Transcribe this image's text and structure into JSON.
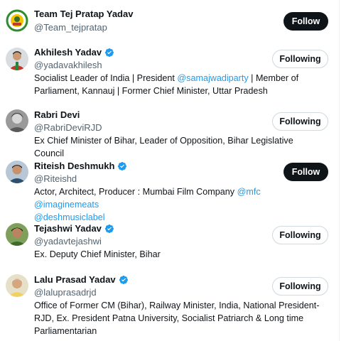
{
  "accounts": [
    {
      "name": "Team Tej Pratap Yadav",
      "handle": "@Team_tejpratap",
      "verified": false,
      "button": "Follow",
      "bio": []
    },
    {
      "name": "Akhilesh Yadav",
      "handle": "@yadavakhilesh",
      "verified": true,
      "button": "Following",
      "bio_line1_a": "Socialist Leader of India | President ",
      "bio_line1_link": "@samajwadiparty",
      "bio_line1_b": " | Member of",
      "bio_line2": "Parliament, Kannauj | Former Chief Minister, Uttar Pradesh"
    },
    {
      "name": "Rabri Devi",
      "handle": "@RabriDeviRJD",
      "verified": false,
      "button": "Following",
      "bio_line1": "Ex Chief Minister of Bihar, Leader of Opposition, Bihar Legislative Council"
    },
    {
      "name": "Riteish Deshmukh",
      "handle": "@Riteishd",
      "verified": true,
      "button": "Follow",
      "bio_line1_a": "Actor, Architect, Producer : Mumbai Film Company ",
      "bio_line1_link1": "@mfc",
      "bio_line1_link2": "@imaginemeats",
      "bio_line2_link": "@deshmusiclabel"
    },
    {
      "name": "Tejashwi Yadav",
      "handle": "@yadavtejashwi",
      "verified": true,
      "button": "Following",
      "bio_line1": "Ex. Deputy Chief Minister, Bihar"
    },
    {
      "name": "Lalu Prasad Yadav",
      "handle": "@laluprasadrjd",
      "verified": true,
      "button": "Following",
      "bio_line1": "Office of Former CM (Bihar), Railway Minister, India, National President-",
      "bio_line2": "RJD, Ex. President Patna University, Socialist Patriarch & Long time",
      "bio_line3": "Parliamentarian"
    }
  ],
  "colors": {
    "verified": "#1d9bf0",
    "link": "#1d9bf0",
    "follow_bg": "#0f1419",
    "secondary_text": "#536471"
  }
}
